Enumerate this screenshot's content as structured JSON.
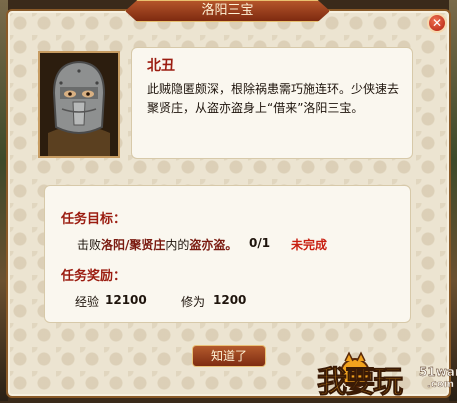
{
  "window": {
    "title": "洛阳三宝",
    "close_label": "✕"
  },
  "npc": {
    "name": "北丑",
    "description": "此贼隐匿颇深，根除祸患需巧施连环。少侠速去聚贤庄，从盗亦盗身上“借来”洛阳三宝。"
  },
  "task": {
    "goal_label": "任务目标：",
    "goal": {
      "prefix": "击败",
      "location": "洛阳/聚贤庄",
      "middle": "内的",
      "target": "盗亦盗。",
      "progress": "0/1",
      "status": "未完成"
    },
    "reward_label": "任务奖励：",
    "rewards": [
      {
        "name": "经验",
        "value": "12100"
      },
      {
        "name": "修为",
        "value": "1200"
      }
    ]
  },
  "buttons": {
    "ok_label": "知道了"
  },
  "watermark": {
    "text": "我要玩",
    "site": "51wan",
    "domain": ".com"
  },
  "colors": {
    "title_bar": "#9a3b1a",
    "name_red": "#9b1c10",
    "status_red": "#c81e10",
    "panel_bg": "#ece4d1"
  }
}
